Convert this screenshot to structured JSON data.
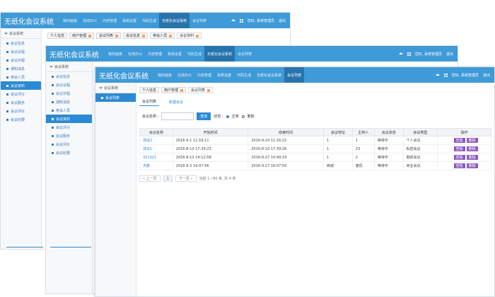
{
  "app": {
    "title": "无纸化会议系统"
  },
  "nav": [
    "我的面板",
    "在线办公",
    "内容管理",
    "系统设置",
    "代码生成",
    "无纸化会议系统",
    "会议列表"
  ],
  "nav_active": "无纸化会议系统",
  "header": {
    "greeting": "您好, 系统管理员",
    "logout": "退出"
  },
  "sidebar": {
    "title": "会议系统",
    "items": [
      "会议信息",
      "会议议程",
      "会议日程",
      "通知消息",
      "参会人员",
      "会议资料",
      "会议评分",
      "会议服务",
      "会议评价",
      "会议纪要"
    ],
    "short_items": [
      "会议列表"
    ]
  },
  "tabs": [
    {
      "label": "个人信息"
    },
    {
      "label": "用户管理"
    },
    {
      "label": "会议列表"
    },
    {
      "label": "会议列表"
    },
    {
      "label": "会议信息"
    },
    {
      "label": "参会人员"
    },
    {
      "label": "会议资料"
    }
  ],
  "front_tabs": [
    {
      "label": "个人信息"
    },
    {
      "label": "用户管理"
    },
    {
      "label": "会议列表"
    }
  ],
  "subtabs": {
    "list": "会议列表",
    "add": "新建会议"
  },
  "search": {
    "label": "会议名称 :",
    "placeholder": "",
    "button": "查询",
    "status_label": "状态 :",
    "opt_normal": "正常",
    "opt_deleted": "删除"
  },
  "table": {
    "headers": [
      "会议名称",
      "开始时间",
      "结束时间",
      "会议地址",
      "主持人",
      "会议状态",
      "会议类型",
      "操作"
    ],
    "rows": [
      [
        "测试2",
        "2016-9-1 11:16:11",
        "2016-9-24 11:16:22",
        "1",
        "1",
        "等待中",
        "个人会议"
      ],
      [
        "测试1",
        "2016-8-10 17:39:23",
        "2016-8-10 17:39:26",
        "1",
        "23",
        "等待中",
        "私密会议"
      ],
      [
        "321321",
        "2016-8-12 14:12:58",
        "2016-8-27 10:49:33",
        "1",
        "2",
        "等待中",
        "融资会议"
      ],
      [
        "天鹅",
        "2016-9-2 16:07:56",
        "2016-9-27 16:07:59",
        "西城",
        "童侃",
        "等待中",
        "商业会议"
      ]
    ],
    "op_view": "查看",
    "op_edit": "删除"
  },
  "pager": {
    "prev": "« 上一页",
    "page": "1",
    "next": "下一页 »",
    "info": "当前 1 / 80 条, 共 4 条"
  },
  "colors": {
    "topbar": "#3f9ad8",
    "accent": "#2b8ad3",
    "nav_active": "#2774ad",
    "op_button": "#8f5bbf",
    "tab_close": "#f0a060"
  }
}
